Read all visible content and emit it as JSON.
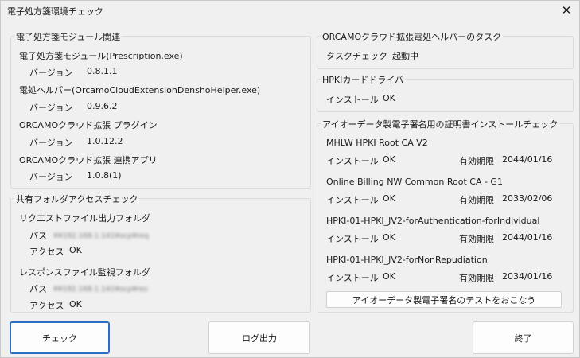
{
  "window": {
    "title": "電子処方箋環境チェック"
  },
  "left": {
    "module_group": {
      "legend": "電子処方箋モジュール関連",
      "items": [
        {
          "name": "電子処方箋モジュール(Prescription.exe)",
          "version_label": "バージョン",
          "version": "0.8.1.1"
        },
        {
          "name": "電処ヘルパー(OrcamoCloudExtensionDenshoHelper.exe)",
          "version_label": "バージョン",
          "version": "0.9.6.2"
        },
        {
          "name": "ORCAMOクラウド拡張 プラグイン",
          "version_label": "バージョン",
          "version": "1.0.12.2"
        },
        {
          "name": "ORCAMOクラウド拡張 連携アプリ",
          "version_label": "バージョン",
          "version": "1.0.8(1)"
        }
      ]
    },
    "shared_group": {
      "legend": "共有フォルダアクセスチェック",
      "request": {
        "name": "リクエストファイル出力フォルダ",
        "path_label": "パス",
        "path": "¥¥192.168.1.141¥ocp¥req",
        "access_label": "アクセス",
        "access": "OK"
      },
      "response": {
        "name": "レスポンスファイル監視フォルダ",
        "path_label": "パス",
        "path": "¥¥192.168.1.141¥ocp¥res",
        "access_label": "アクセス",
        "access": "OK"
      }
    }
  },
  "right": {
    "task_group": {
      "legend": "ORCAMOクラウド拡張電処ヘルパーのタスク",
      "label": "タスクチェック",
      "value": "起動中"
    },
    "hpki_group": {
      "legend": "HPKIカードドライバ",
      "label": "インストール",
      "value": "OK"
    },
    "cert_group": {
      "legend": "アイオーデータ製電子署名用の証明書インストールチェック",
      "install_label": "インストール",
      "expiry_label": "有効期限",
      "certs": [
        {
          "name": "MHLW HPKI Root CA V2",
          "status": "OK",
          "expiry": "2044/01/16"
        },
        {
          "name": "Online Billing NW Common Root CA - G1",
          "status": "OK",
          "expiry": "2033/02/06"
        },
        {
          "name": "HPKI-01-HPKI_JV2-forAuthentication-forIndividual",
          "status": "OK",
          "expiry": "2044/01/16"
        },
        {
          "name": "HPKI-01-HPKI_JV2-forNonRepudiation",
          "status": "OK",
          "expiry": "2034/01/16"
        }
      ],
      "test_button": "アイオーデータ製電子署名のテストをおこなう"
    }
  },
  "buttons": {
    "check": "チェック",
    "log": "ログ出力",
    "exit": "終了"
  }
}
